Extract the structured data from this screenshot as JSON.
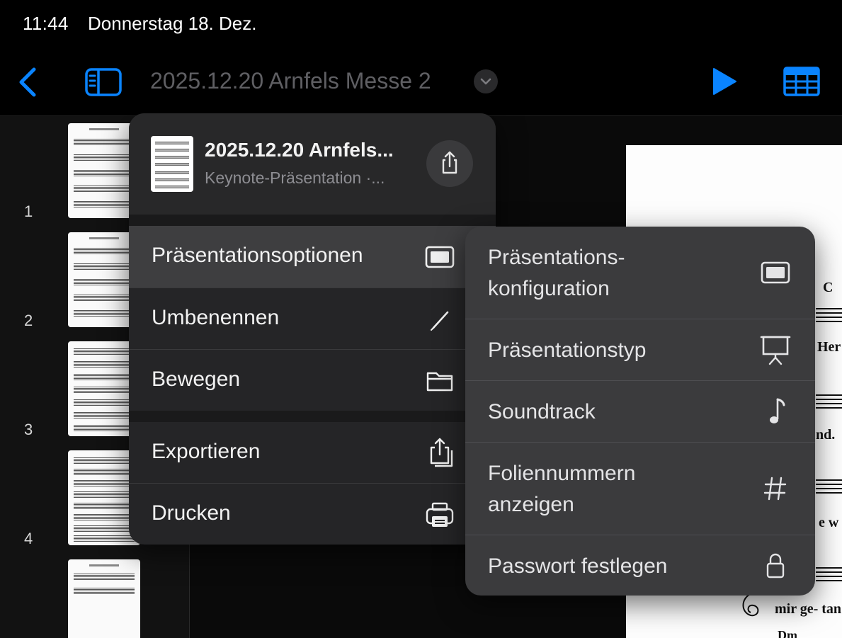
{
  "status_bar": {
    "time": "11:44",
    "date": "Donnerstag 18. Dez."
  },
  "toolbar": {
    "title": "2025.12.20 Arnfels Messe 2",
    "icons": [
      "chevron-left-icon",
      "sidebar-icon",
      "chevron-down-icon",
      "play-icon",
      "table-icon"
    ]
  },
  "navigator": {
    "slide_numbers": [
      "1",
      "2",
      "3",
      "4"
    ]
  },
  "menu": {
    "document": {
      "name": "2025.12.20 Arnfels...",
      "subtitle": "Keynote-Präsentation ·..."
    },
    "items": [
      {
        "label": "Präsentationsoptionen",
        "icon": "presentation-icon"
      },
      {
        "label": "Umbenennen",
        "icon": "pencil-icon"
      },
      {
        "label": "Bewegen",
        "icon": "folder-icon"
      },
      {
        "label": "Exportieren",
        "icon": "export-icon"
      },
      {
        "label": "Drucken",
        "icon": "printer-icon"
      }
    ]
  },
  "submenu": {
    "items": [
      {
        "label": "Präsentations-\nkonfiguration",
        "icon": "presentation-icon"
      },
      {
        "label": "Präsentationstyp",
        "icon": "easel-icon"
      },
      {
        "label": "Soundtrack",
        "icon": "music-note-icon"
      },
      {
        "label": "Foliennummern\nanzeigen",
        "icon": "hash-icon"
      },
      {
        "label": "Passwort festlegen",
        "icon": "lock-icon"
      }
    ]
  },
  "slide_preview": {
    "texts": [
      "C",
      "Her",
      "nd.",
      "e w",
      "mir ge- tan",
      "Dm"
    ]
  },
  "colors": {
    "accent": "#0a84ff",
    "menu_bg": "#252527",
    "submenu_bg": "#3b3b3d"
  }
}
